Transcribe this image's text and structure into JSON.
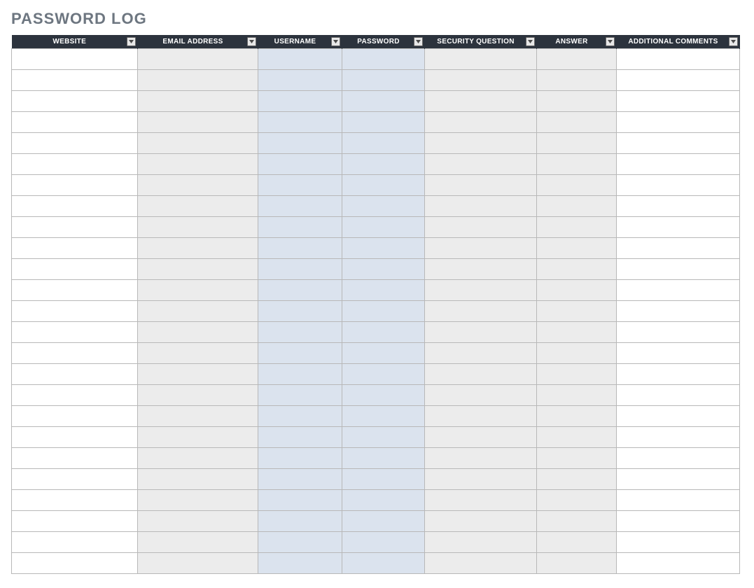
{
  "title": "PASSWORD LOG",
  "columns": [
    {
      "key": "website",
      "label": "WEBSITE"
    },
    {
      "key": "email",
      "label": "EMAIL ADDRESS"
    },
    {
      "key": "username",
      "label": "USERNAME"
    },
    {
      "key": "password",
      "label": "PASSWORD"
    },
    {
      "key": "secq",
      "label": "SECURITY QUESTION"
    },
    {
      "key": "answer",
      "label": "ANSWER"
    },
    {
      "key": "comments",
      "label": "ADDITIONAL COMMENTS"
    }
  ],
  "rows": [
    {
      "website": "",
      "email": "",
      "username": "",
      "password": "",
      "secq": "",
      "answer": "",
      "comments": ""
    },
    {
      "website": "",
      "email": "",
      "username": "",
      "password": "",
      "secq": "",
      "answer": "",
      "comments": ""
    },
    {
      "website": "",
      "email": "",
      "username": "",
      "password": "",
      "secq": "",
      "answer": "",
      "comments": ""
    },
    {
      "website": "",
      "email": "",
      "username": "",
      "password": "",
      "secq": "",
      "answer": "",
      "comments": ""
    },
    {
      "website": "",
      "email": "",
      "username": "",
      "password": "",
      "secq": "",
      "answer": "",
      "comments": ""
    },
    {
      "website": "",
      "email": "",
      "username": "",
      "password": "",
      "secq": "",
      "answer": "",
      "comments": ""
    },
    {
      "website": "",
      "email": "",
      "username": "",
      "password": "",
      "secq": "",
      "answer": "",
      "comments": ""
    },
    {
      "website": "",
      "email": "",
      "username": "",
      "password": "",
      "secq": "",
      "answer": "",
      "comments": ""
    },
    {
      "website": "",
      "email": "",
      "username": "",
      "password": "",
      "secq": "",
      "answer": "",
      "comments": ""
    },
    {
      "website": "",
      "email": "",
      "username": "",
      "password": "",
      "secq": "",
      "answer": "",
      "comments": ""
    },
    {
      "website": "",
      "email": "",
      "username": "",
      "password": "",
      "secq": "",
      "answer": "",
      "comments": ""
    },
    {
      "website": "",
      "email": "",
      "username": "",
      "password": "",
      "secq": "",
      "answer": "",
      "comments": ""
    },
    {
      "website": "",
      "email": "",
      "username": "",
      "password": "",
      "secq": "",
      "answer": "",
      "comments": ""
    },
    {
      "website": "",
      "email": "",
      "username": "",
      "password": "",
      "secq": "",
      "answer": "",
      "comments": ""
    },
    {
      "website": "",
      "email": "",
      "username": "",
      "password": "",
      "secq": "",
      "answer": "",
      "comments": ""
    },
    {
      "website": "",
      "email": "",
      "username": "",
      "password": "",
      "secq": "",
      "answer": "",
      "comments": ""
    },
    {
      "website": "",
      "email": "",
      "username": "",
      "password": "",
      "secq": "",
      "answer": "",
      "comments": ""
    },
    {
      "website": "",
      "email": "",
      "username": "",
      "password": "",
      "secq": "",
      "answer": "",
      "comments": ""
    },
    {
      "website": "",
      "email": "",
      "username": "",
      "password": "",
      "secq": "",
      "answer": "",
      "comments": ""
    },
    {
      "website": "",
      "email": "",
      "username": "",
      "password": "",
      "secq": "",
      "answer": "",
      "comments": ""
    },
    {
      "website": "",
      "email": "",
      "username": "",
      "password": "",
      "secq": "",
      "answer": "",
      "comments": ""
    },
    {
      "website": "",
      "email": "",
      "username": "",
      "password": "",
      "secq": "",
      "answer": "",
      "comments": ""
    },
    {
      "website": "",
      "email": "",
      "username": "",
      "password": "",
      "secq": "",
      "answer": "",
      "comments": ""
    },
    {
      "website": "",
      "email": "",
      "username": "",
      "password": "",
      "secq": "",
      "answer": "",
      "comments": ""
    },
    {
      "website": "",
      "email": "",
      "username": "",
      "password": "",
      "secq": "",
      "answer": "",
      "comments": ""
    }
  ]
}
